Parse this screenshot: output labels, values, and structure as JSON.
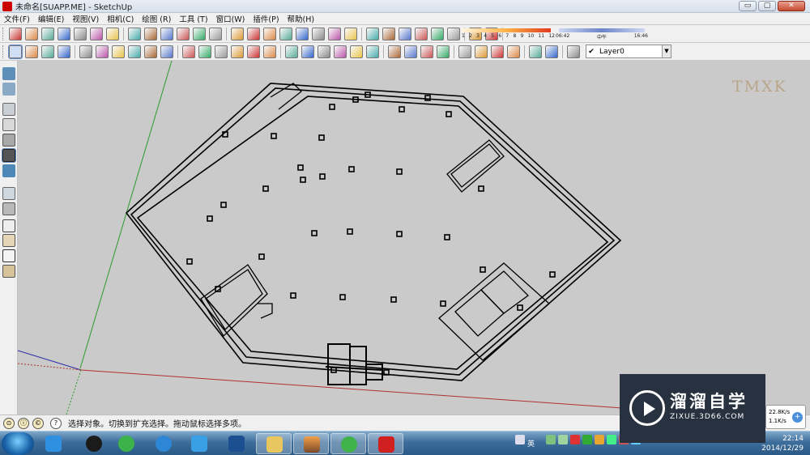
{
  "window": {
    "title": "未命名[SUAPP.ME] - SketchUp",
    "min": "▭",
    "max": "▢",
    "close": "✕"
  },
  "menu": [
    "文件(F)",
    "编辑(E)",
    "视图(V)",
    "相机(C)",
    "绘图 (R)",
    "工具 (T)",
    "窗口(W)",
    "插件(P)",
    "帮助(H)"
  ],
  "shadow": {
    "months": [
      "1",
      "2",
      "3",
      "4",
      "5",
      "6",
      "7",
      "8",
      "9",
      "10",
      "11",
      "12"
    ],
    "times": [
      "06:42",
      "中午",
      "16:46"
    ]
  },
  "layer": {
    "name": "Layer0",
    "check": "✔",
    "arrow": "▼"
  },
  "watermark": "TMXK",
  "status": {
    "text": "选择对象。切换到扩充选择。拖动鼠标选择多项。",
    "help": "?"
  },
  "logo": {
    "cn": "溜溜自学",
    "url": "ZIXUE.3D66.COM"
  },
  "net": {
    "up": "22.8K/s",
    "down": "1.1K/s",
    "btn": "+"
  },
  "taskbar": {
    "lang": "英",
    "time": "22:14",
    "date": "2014/12/29"
  },
  "colors": {
    "x_axis": "#b03030",
    "y_axis": "#2c9a2c",
    "z_axis": "#2a2aa8",
    "viewport_bg": "#cacaca"
  },
  "icons": {
    "toolbar1": [
      "tool-icon-1",
      "tool-icon-2",
      "tool-icon-3",
      "tool-icon-4",
      "tool-icon-5",
      "tool-icon-6",
      "tool-icon-7",
      "tool-icon-8",
      "tool-icon-9",
      "tool-icon-10",
      "tool-icon-11",
      "tool-icon-12",
      "tool-icon-13",
      "tool-icon-14",
      "tool-icon-15",
      "tool-icon-16",
      "tool-icon-17",
      "tool-icon-18",
      "tool-icon-19",
      "tool-icon-20",
      "tool-icon-21",
      "tool-icon-22",
      "tool-icon-23",
      "tool-icon-24",
      "tool-icon-25",
      "tool-icon-26",
      "tool-icon-27",
      "suapp-icon",
      "shadow-icon"
    ],
    "toolbar2": [
      "select-icon",
      "component-icon",
      "paint-icon",
      "eraser-icon",
      "rectangle-icon",
      "line-icon",
      "circle-icon",
      "arc-icon",
      "polygon-icon",
      "freehand-icon",
      "move-icon",
      "pushpull-icon",
      "rotate-icon",
      "followme-icon",
      "scale-icon",
      "offset-icon",
      "tape-icon",
      "dimension-icon",
      "protractor-icon",
      "text-icon",
      "axes-icon",
      "3dtext-icon",
      "orbit-icon",
      "pan-icon",
      "zoom-icon",
      "zoom-window-icon",
      "zoom-extents-icon",
      "position-camera-icon",
      "look-around-icon",
      "walk-icon",
      "section-icon",
      "section-display-icon",
      "layer-manager-icon"
    ]
  }
}
